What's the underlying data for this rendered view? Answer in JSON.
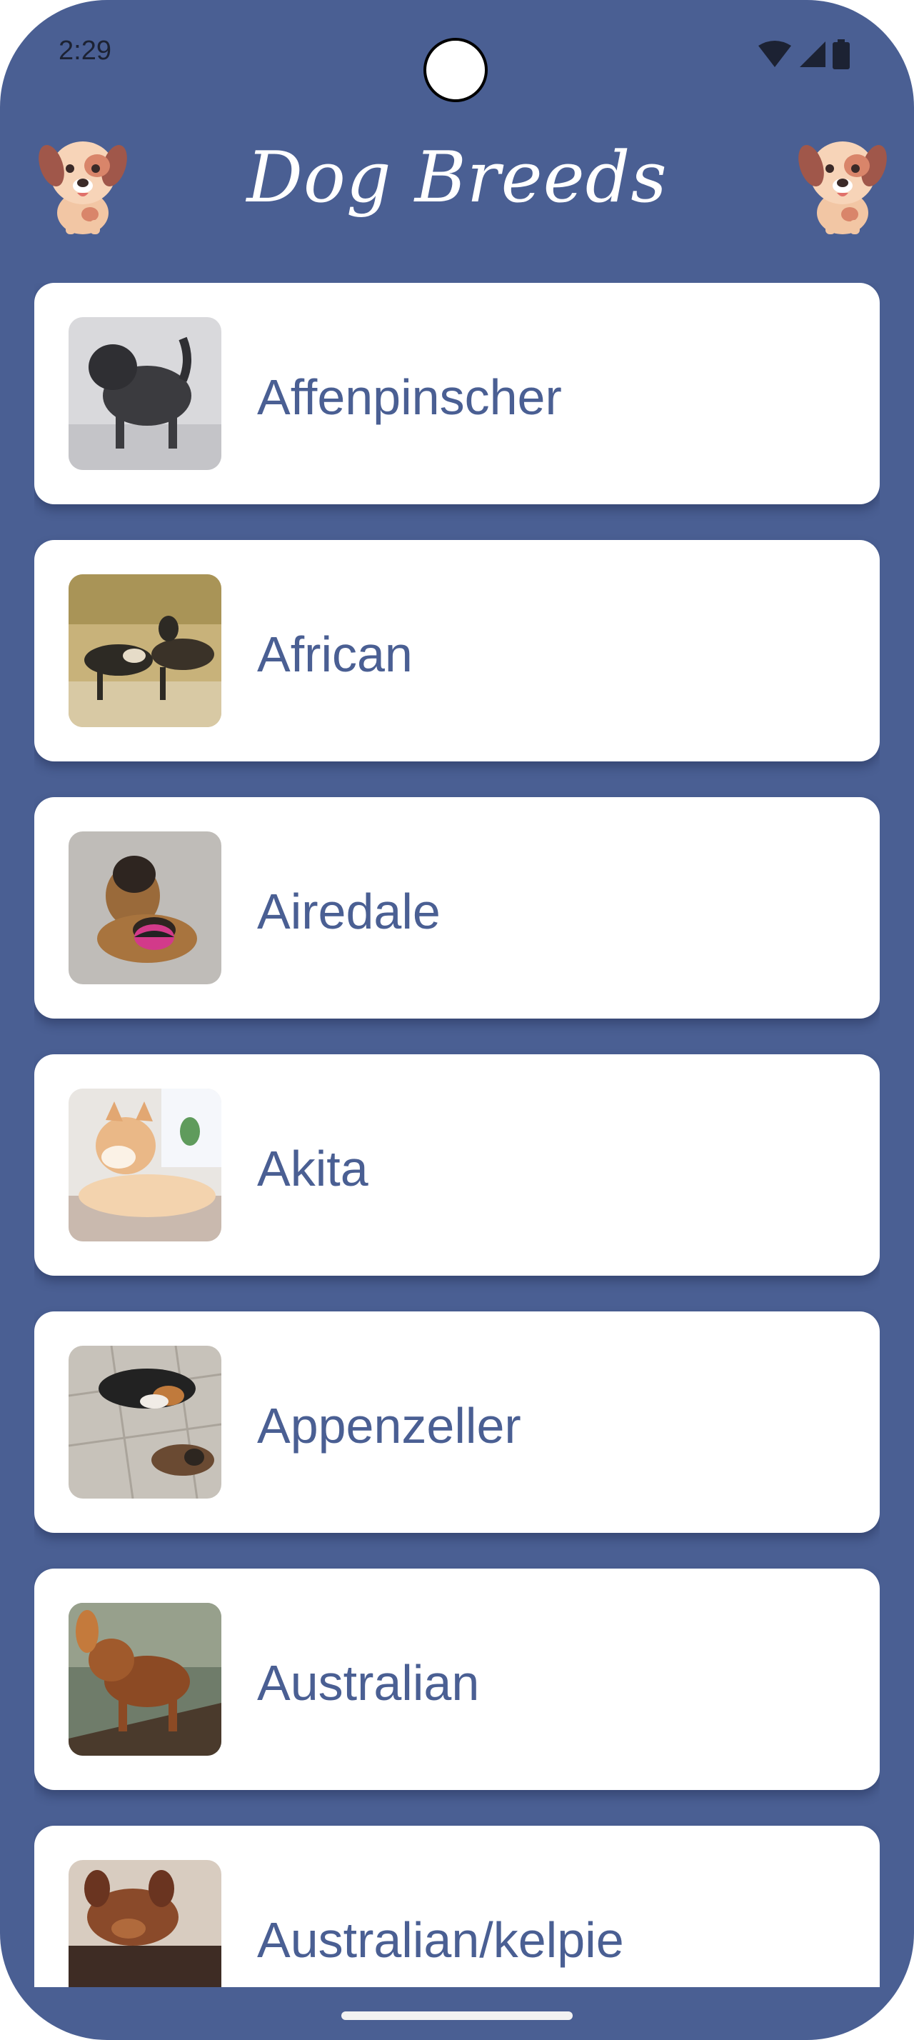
{
  "status_bar": {
    "time": "2:29",
    "icons": [
      "wifi-icon",
      "cellular-signal-icon",
      "battery-icon"
    ]
  },
  "header": {
    "title": "Dog Breeds",
    "mascot_icon": "puppy-face-icon"
  },
  "colors": {
    "background": "#4a5f93",
    "card": "#ffffff",
    "text_accent": "#4a5f93"
  },
  "breeds": [
    {
      "name": "Affenpinscher",
      "thumbnail": "affenpinscher-photo"
    },
    {
      "name": "African",
      "thumbnail": "african-wild-dog-photo"
    },
    {
      "name": "Airedale",
      "thumbnail": "airedale-photo"
    },
    {
      "name": "Akita",
      "thumbnail": "akita-photo"
    },
    {
      "name": "Appenzeller",
      "thumbnail": "appenzeller-photo"
    },
    {
      "name": "Australian",
      "thumbnail": "australian-shepherd-photo"
    },
    {
      "name": "Australian/kelpie",
      "thumbnail": "kelpie-photo"
    }
  ]
}
